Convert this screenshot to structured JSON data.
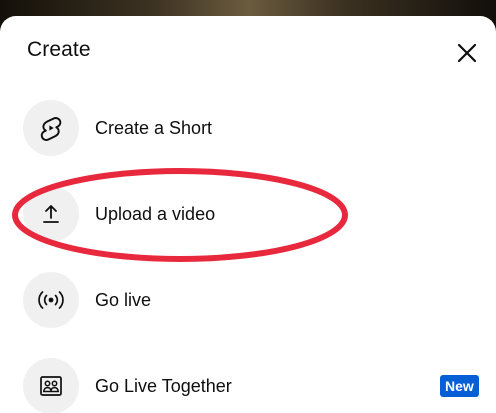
{
  "sheet": {
    "title": "Create",
    "close_icon": "close-icon"
  },
  "menu": {
    "items": [
      {
        "label": "Create a Short",
        "icon": "shorts-icon"
      },
      {
        "label": "Upload a video",
        "icon": "upload-icon"
      },
      {
        "label": "Go live",
        "icon": "live-broadcast-icon"
      },
      {
        "label": "Go Live Together",
        "icon": "go-live-together-icon",
        "badge": "New"
      }
    ]
  },
  "colors": {
    "highlight": "#e8283c",
    "badge": "#065fd4",
    "icon_bg": "#f0f0f0"
  }
}
